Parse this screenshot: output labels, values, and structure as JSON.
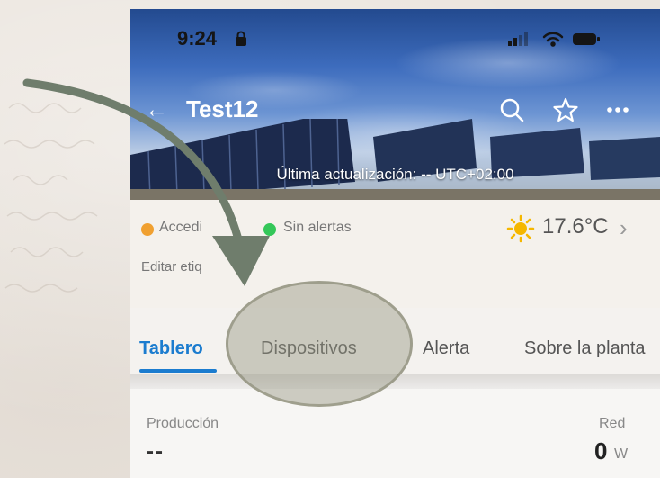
{
  "status_bar": {
    "time": "9:24"
  },
  "header": {
    "back_label": "←",
    "title": "Test12"
  },
  "hero": {
    "last_update": "Última actualización: -- UTC+02:00"
  },
  "info": {
    "connection_status": "Accedi",
    "alerts_status": "Sin alertas",
    "temperature": "17.6°C",
    "edit_tags": "Editar etiq"
  },
  "tabs": [
    {
      "label": "Tablero",
      "active": true
    },
    {
      "label": "Dispositivos",
      "active": false
    },
    {
      "label": "Alerta",
      "active": false
    },
    {
      "label": "Sobre la planta",
      "active": false
    }
  ],
  "dashboard": {
    "production_label": "Producción",
    "production_value": "--",
    "grid_label": "Red",
    "grid_value": "0",
    "grid_unit": "W"
  },
  "colors": {
    "accent": "#1b7ccf",
    "status_orange": "#f0a030",
    "status_green": "#34c759",
    "arrow": "#6f7d6c",
    "highlight": "#96968a"
  },
  "icons": [
    "back-arrow-icon",
    "search-icon",
    "star-icon",
    "more-icon",
    "sun-icon",
    "chevron-right-icon",
    "wifi-icon",
    "battery-icon",
    "signal-icon",
    "lock-icon"
  ]
}
